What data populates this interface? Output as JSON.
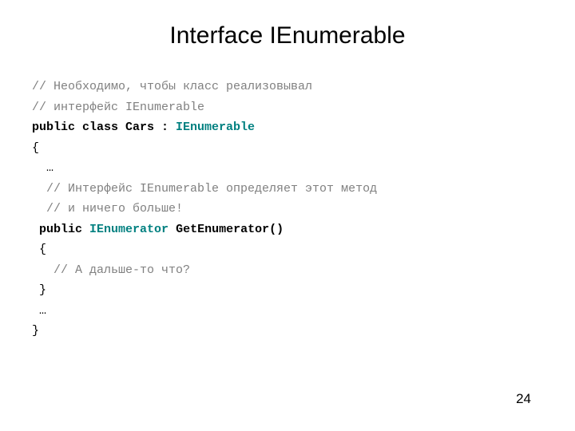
{
  "title": "Interface IEnumerable",
  "page_number": "24",
  "code": {
    "comment1": "// Необходимо, чтобы класс реализовывал",
    "comment2": "// интерфейс IEnumerable",
    "decl_public_class": "public class ",
    "decl_cars_colon": "Cars : ",
    "decl_ienumerable": "IEnumerable",
    "brace_open1": "{",
    "ellipsis1": "  …",
    "comment3": "  // Интерфейс IEnumerable определяет этот метод",
    "comment4": "  // и ничего больше!",
    "method_indent": " ",
    "method_public": "public ",
    "method_type": "IEnumerator ",
    "method_name": "GetEnumerator()",
    "brace_open2": " {",
    "comment5": "   // А дальше-то что?",
    "brace_close2": " }",
    "ellipsis2": " …",
    "brace_close1": "}"
  }
}
